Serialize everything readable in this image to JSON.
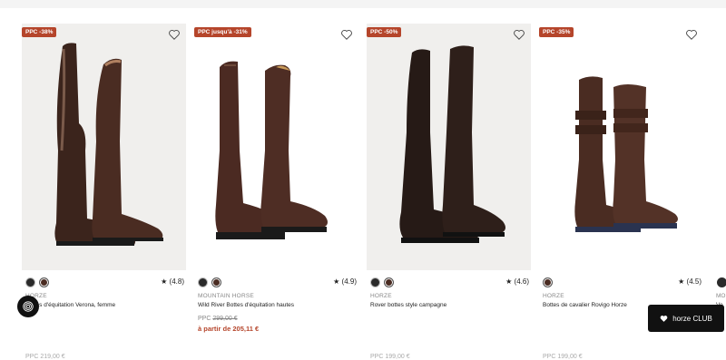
{
  "products": [
    {
      "badge": "PPC -38%",
      "rating": "★ (4.8)",
      "brand": "HORZE",
      "name": "Bottes d'équitation Verona, femme",
      "price_old_line": "",
      "price_from": "",
      "cutoff": "PPC 219,00 €",
      "swatches": [
        "dark",
        "brown"
      ]
    },
    {
      "badge": "PPC jusqu'à -31%",
      "rating": "★ (4.9)",
      "brand": "MOUNTAIN HORSE",
      "name": "Wild River Bottes d'équitation hautes",
      "price_prefix": "PPC ",
      "price_old": "299,00 €",
      "price_from": "à partir de 205,11 €",
      "swatches": [
        "dark",
        "brown"
      ]
    },
    {
      "badge": "PPC -50%",
      "rating": "★ (4.6)",
      "brand": "HORZE",
      "name": "Rover bottes style campagne",
      "price_old_line": "",
      "price_from": "",
      "cutoff": "PPC 199,00 €",
      "swatches": [
        "dark",
        "brown"
      ]
    },
    {
      "badge": "PPC -35%",
      "rating": "★ (4.5)",
      "brand": "HORZE",
      "name": "Bottes de cavalier Rovigo Horze",
      "price_old_line": "",
      "price_from": "",
      "cutoff": "PPC 199,00 €",
      "swatches": [
        "brown"
      ]
    }
  ],
  "partial": {
    "brand": "MO",
    "name": "Ve"
  },
  "club_button": {
    "label": "horze CLUB"
  },
  "colors": {
    "badge": "#b5452b",
    "price": "#b5452b",
    "boot_brown": "#4a2c22"
  }
}
